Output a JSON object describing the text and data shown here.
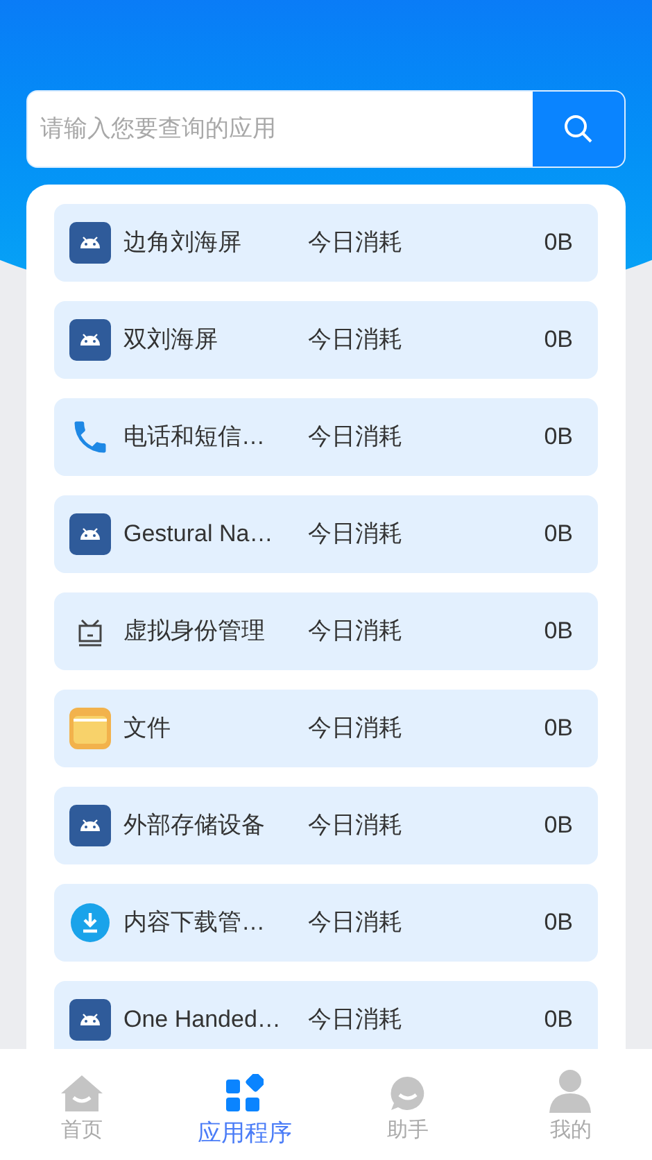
{
  "search": {
    "placeholder": "请输入您要查询的应用"
  },
  "apps": [
    {
      "name": "边角刘海屏",
      "kind": "android",
      "label": "今日消耗",
      "usage": "0B"
    },
    {
      "name": "双刘海屏",
      "kind": "android",
      "label": "今日消耗",
      "usage": "0B"
    },
    {
      "name": "电话和短信…",
      "kind": "phone",
      "label": "今日消耗",
      "usage": "0B"
    },
    {
      "name": "Gestural Na…",
      "kind": "android",
      "label": "今日消耗",
      "usage": "0B"
    },
    {
      "name": "虚拟身份管理",
      "kind": "tv",
      "label": "今日消耗",
      "usage": "0B"
    },
    {
      "name": "文件",
      "kind": "folder",
      "label": "今日消耗",
      "usage": "0B"
    },
    {
      "name": "外部存储设备",
      "kind": "android",
      "label": "今日消耗",
      "usage": "0B"
    },
    {
      "name": "内容下载管…",
      "kind": "download",
      "label": "今日消耗",
      "usage": "0B"
    },
    {
      "name": "One Handed…",
      "kind": "android",
      "label": "今日消耗",
      "usage": "0B"
    }
  ],
  "nav": [
    {
      "label": "首页",
      "kind": "home",
      "selected": false
    },
    {
      "label": "应用程序",
      "kind": "apps",
      "selected": true
    },
    {
      "label": "助手",
      "kind": "chat",
      "selected": false
    },
    {
      "label": "我的",
      "kind": "user",
      "selected": false
    }
  ]
}
